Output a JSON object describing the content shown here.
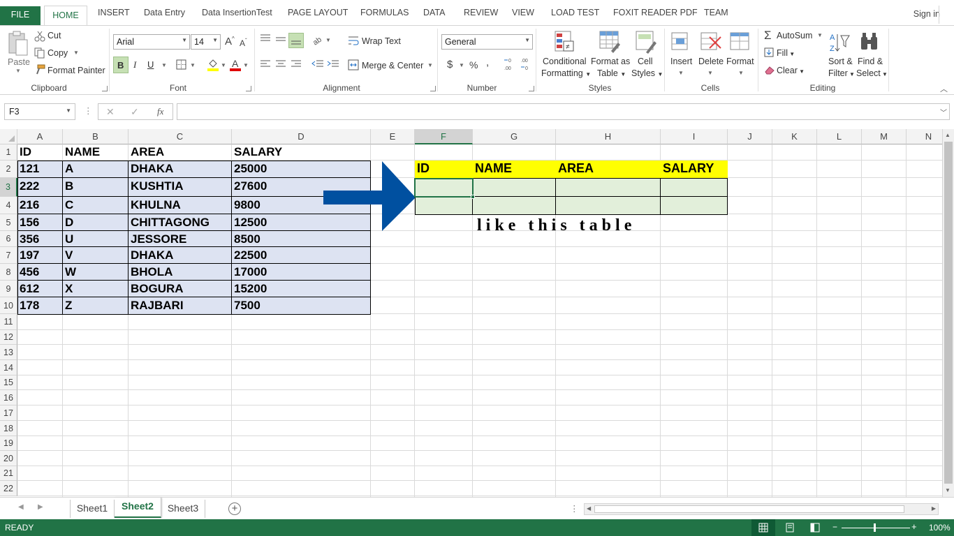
{
  "ribbon_tabs": [
    "FILE",
    "HOME",
    "INSERT",
    "Data Entry",
    "Data InsertionTest",
    "PAGE LAYOUT",
    "FORMULAS",
    "DATA",
    "REVIEW",
    "VIEW",
    "LOAD TEST",
    "FOXIT READER PDF",
    "TEAM"
  ],
  "sign_in": "Sign in",
  "clipboard": {
    "paste": "Paste",
    "cut": "Cut",
    "copy": "Copy",
    "format_painter": "Format Painter",
    "label": "Clipboard"
  },
  "font": {
    "name": "Arial",
    "size": "14",
    "label": "Font",
    "bold": "B",
    "italic": "I",
    "underline": "U"
  },
  "alignment": {
    "wrap_text": "Wrap Text",
    "merge_center": "Merge & Center",
    "label": "Alignment"
  },
  "number": {
    "format": "General",
    "currency": "$",
    "percent": "%",
    "comma": ",",
    "label": "Number"
  },
  "styles": {
    "conditional": "Conditional",
    "formatting": "Formatting",
    "format_as": "Format as",
    "table": "Table",
    "cell": "Cell",
    "cell_styles": "Styles",
    "label": "Styles"
  },
  "cells": {
    "insert": "Insert",
    "delete": "Delete",
    "format": "Format",
    "label": "Cells"
  },
  "editing": {
    "autosum": "AutoSum",
    "fill": "Fill",
    "clear": "Clear",
    "sort": "Sort &",
    "filter": "Filter",
    "find": "Find &",
    "select": "Select",
    "label": "Editing"
  },
  "formula_bar": {
    "name_box": "F3",
    "fx": "fx",
    "formula": ""
  },
  "columns": [
    "A",
    "B",
    "C",
    "D",
    "E",
    "F",
    "G",
    "H",
    "I",
    "J",
    "K",
    "L",
    "M",
    "N"
  ],
  "rows": [
    "1",
    "2",
    "3",
    "4",
    "5",
    "6",
    "7",
    "8",
    "9",
    "10",
    "11",
    "12",
    "13",
    "14",
    "15",
    "16",
    "17",
    "18",
    "19",
    "20",
    "21",
    "22"
  ],
  "source_table": {
    "headers": [
      "ID",
      "NAME",
      "AREA",
      "SALARY"
    ],
    "rows": [
      [
        "121",
        "A",
        "DHAKA",
        "25000"
      ],
      [
        "222",
        "B",
        "KUSHTIA",
        "27600"
      ],
      [
        "216",
        "C",
        "KHULNA",
        "9800"
      ],
      [
        "156",
        "D",
        "CHITTAGONG",
        "12500"
      ],
      [
        "356",
        "U",
        "JESSORE",
        "8500"
      ],
      [
        "197",
        "V",
        "DHAKA",
        "22500"
      ],
      [
        "456",
        "W",
        "BHOLA",
        "17000"
      ],
      [
        "612",
        "X",
        "BOGURA",
        "15200"
      ],
      [
        "178",
        "Z",
        "RAJBARI",
        "7500"
      ]
    ]
  },
  "target_table": {
    "headers": [
      "ID",
      "NAME",
      "AREA",
      "SALARY"
    ],
    "header_color": "#ffff00",
    "body_color": "#e2efda"
  },
  "annotation": "like this table",
  "sheets": [
    "Sheet1",
    "Sheet2",
    "Sheet3"
  ],
  "active_sheet": "Sheet2",
  "status": {
    "ready": "READY",
    "zoom": "100%"
  },
  "colors": {
    "accent": "#217346",
    "arrow": "#0050a0",
    "source_fill": "#dde3f2"
  }
}
